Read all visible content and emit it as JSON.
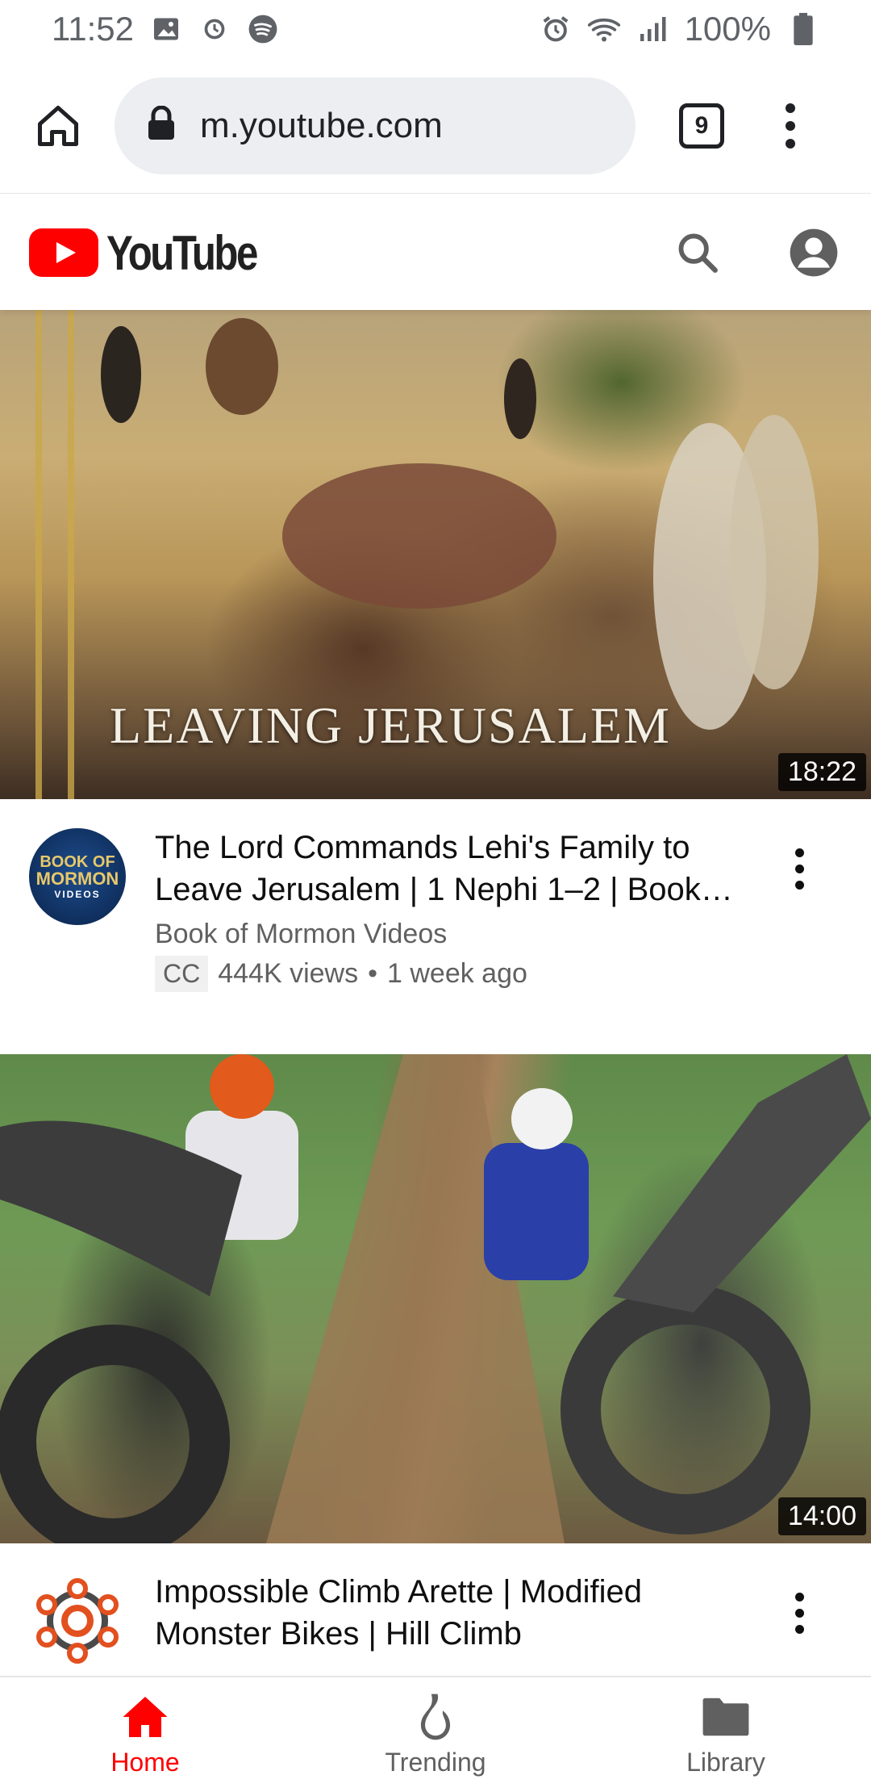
{
  "status_bar": {
    "time": "11:52",
    "battery": "100%",
    "left_icons": [
      "image-icon",
      "watch-icon",
      "spotify-icon"
    ],
    "right_icons": [
      "alarm-icon",
      "wifi-icon",
      "signal-icon",
      "battery-icon"
    ]
  },
  "browser": {
    "url": "m.youtube.com",
    "tab_count": "9"
  },
  "youtube": {
    "logo_text": "YouTube",
    "brand_color": "#ff0000"
  },
  "videos": [
    {
      "thumbnail_text": "LEAVING JERUSALEM",
      "duration": "18:22",
      "title": "The Lord Commands Lehi's Family to Leave Jerusalem | 1 Nephi 1–2 | Book…",
      "title_line1": "The Lord Commands Lehi's Family to",
      "title_line2": "Leave Jerusalem | 1 Nephi 1–2 | Book…",
      "channel": "Book of Mormon Videos",
      "badge": "CC",
      "views": "444K views",
      "age": "1 week ago",
      "avatar_line1": "BOOK OF",
      "avatar_line2": "MORMON",
      "avatar_line3": "VIDEOS"
    },
    {
      "duration": "14:00",
      "title_line1": "Impossible Climb Arette | Modified",
      "title_line2": "Monster Bikes | Hill Climb"
    }
  ],
  "bottom_nav": {
    "home": "Home",
    "trending": "Trending",
    "library": "Library"
  }
}
